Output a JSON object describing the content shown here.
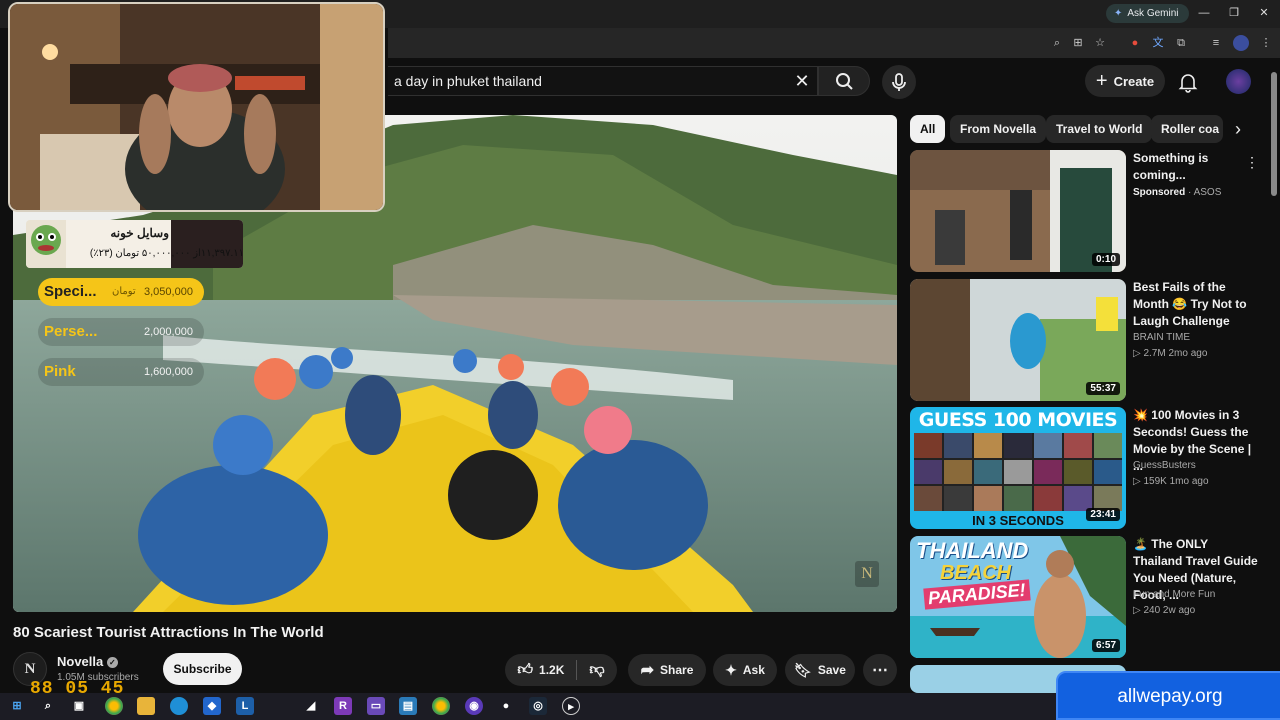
{
  "browser": {
    "ask_gemini": "Ask Gemini",
    "controls": {
      "minimize": "—",
      "restore": "❐",
      "close": "✕"
    }
  },
  "youtube": {
    "search_query": "a day in  phuket thailand",
    "create_label": "Create",
    "chips": [
      "All",
      "From Novella",
      "Travel to World",
      "Roller coa"
    ]
  },
  "stream_overlay": {
    "donation": {
      "name": "وسایل خونه",
      "progress": "۱۱,۳۹۷.۱۱از ۵۰,۰۰۰,۰۰۰ تومان (۲۳٪)"
    },
    "ranks": [
      {
        "label": "Speci...",
        "amount": "3,050,000",
        "currency": "تومان"
      },
      {
        "label": "Perse...",
        "amount": "2,000,000"
      },
      {
        "label": "Pink",
        "amount": "1,600,000"
      }
    ],
    "timer": "88 05 45"
  },
  "video": {
    "title": "80 Scariest Tourist Attractions In The World",
    "channel": "Novella",
    "channel_initial": "N",
    "subscribers": "1.05M subscribers",
    "subscribe_label": "Subscribe",
    "likes": "1.2K",
    "share_label": "Share",
    "ask_label": "Ask",
    "save_label": "Save"
  },
  "recommendations": [
    {
      "title": "Something is coming...",
      "channel": "Sponsored",
      "channel_suffix": "ASOS",
      "meta": "",
      "duration": "0:10"
    },
    {
      "title": "Best Fails of the Month 😂 Try Not to Laugh Challenge",
      "channel": "BRAIN TIME",
      "meta": "2.7M  2mo ago",
      "duration": "55:37"
    },
    {
      "title": "💥 100 Movies in 3 Seconds! Guess the Movie by the Scene | ...",
      "channel": "GuessBusters",
      "meta": "159K  1mo ago",
      "duration": "23:41",
      "thumb_top": "GUESS 100 MOVIES",
      "thumb_bottom": "IN 3 SECONDS"
    },
    {
      "title": "🏝️ The ONLY Thailand Travel Guide You Need (Nature, Food, ...",
      "channel": "Fun and More Fun",
      "meta": "240  2w ago",
      "duration": "6:57",
      "thumb_line1": "THAILAND",
      "thumb_line2": "BEACH",
      "thumb_line3": "PARADISE!"
    }
  ],
  "ad_banner": "allwepay.org",
  "colors": {
    "accent_youtube_red": "#ff0000",
    "timer": "#e8a800",
    "rank_highlight": "#f5c518"
  }
}
